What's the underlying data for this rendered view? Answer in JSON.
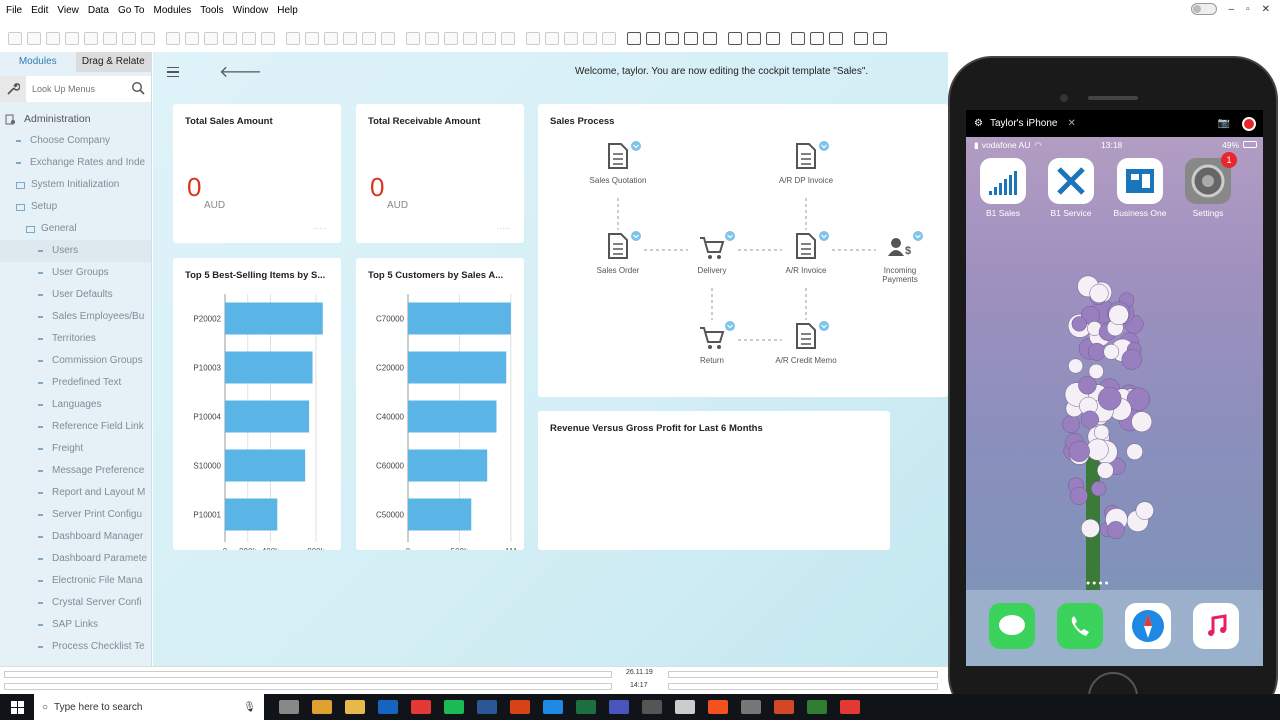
{
  "menu": [
    "File",
    "Edit",
    "View",
    "Data",
    "Go To",
    "Modules",
    "Tools",
    "Window",
    "Help"
  ],
  "window_controls": {
    "minimize": "–",
    "restore": "▫",
    "close": "✕"
  },
  "sidebar": {
    "tabs": [
      "Modules",
      "Drag & Relate"
    ],
    "search_placeholder": "Look Up Menus",
    "root": "Administration",
    "items": [
      {
        "label": "Choose Company",
        "type": "leaf",
        "level": 1
      },
      {
        "label": "Exchange Rates and Inde",
        "type": "leaf",
        "level": 1
      },
      {
        "label": "System Initialization",
        "type": "folder",
        "level": 1
      },
      {
        "label": "Setup",
        "type": "folder",
        "level": 1
      },
      {
        "label": "General",
        "type": "folder",
        "level": 2
      },
      {
        "label": "Users",
        "type": "leaf",
        "level": 3,
        "selected": true
      },
      {
        "label": "User Groups",
        "type": "leaf",
        "level": 3
      },
      {
        "label": "User Defaults",
        "type": "leaf",
        "level": 3
      },
      {
        "label": "Sales Employees/Bu",
        "type": "leaf",
        "level": 3
      },
      {
        "label": "Territories",
        "type": "leaf",
        "level": 3
      },
      {
        "label": "Commission Groups",
        "type": "leaf",
        "level": 3
      },
      {
        "label": "Predefined Text",
        "type": "leaf",
        "level": 3
      },
      {
        "label": "Languages",
        "type": "leaf",
        "level": 3
      },
      {
        "label": "Reference Field Link",
        "type": "leaf",
        "level": 3
      },
      {
        "label": "Freight",
        "type": "leaf",
        "level": 3
      },
      {
        "label": "Message Preference",
        "type": "leaf",
        "level": 3
      },
      {
        "label": "Report and Layout M",
        "type": "leaf",
        "level": 3
      },
      {
        "label": "Server Print Configu",
        "type": "leaf",
        "level": 3
      },
      {
        "label": "Dashboard Manager",
        "type": "leaf",
        "level": 3
      },
      {
        "label": "Dashboard Paramete",
        "type": "leaf",
        "level": 3
      },
      {
        "label": "Electronic File Mana",
        "type": "leaf",
        "level": 3
      },
      {
        "label": "Crystal Server Confi",
        "type": "leaf",
        "level": 3
      },
      {
        "label": "SAP Links",
        "type": "leaf",
        "level": 3
      },
      {
        "label": "Process Checklist Te",
        "type": "leaf",
        "level": 3
      }
    ]
  },
  "header": {
    "welcome": "Welcome, taylor. You are now editing the cockpit template \"Sales\"."
  },
  "kpis": [
    {
      "title": "Total Sales Amount",
      "value": "0",
      "unit": "AUD"
    },
    {
      "title": "Total Receivable Amount",
      "value": "0",
      "unit": "AUD"
    }
  ],
  "sales_process": {
    "title": "Sales Process",
    "nodes": [
      "Sales Quotation",
      "A/R DP Invoice",
      "Sales Order",
      "Delivery",
      "A/R Invoice",
      "Incoming Payments",
      "Return",
      "A/R Credit Memo"
    ]
  },
  "revenue_card": {
    "title": "Revenue Versus Gross Profit for Last 6 Months"
  },
  "chart_data": [
    {
      "type": "bar",
      "title": "Top 5 Best-Selling Items by S...",
      "categories": [
        "P20002",
        "P10003",
        "P10004",
        "S10000",
        "P10001"
      ],
      "values": [
        860000,
        770000,
        740000,
        705000,
        460000
      ],
      "xlim": [
        0,
        950000
      ],
      "ticks": [
        {
          "label": "0",
          "value": 0
        },
        {
          "label": "200k",
          "value": 200000
        },
        {
          "label": "400k",
          "value": 400000
        },
        {
          "label": "800k",
          "value": 800000
        }
      ],
      "color": "#5ab4e5"
    },
    {
      "type": "bar",
      "title": "Top 5 Customers by Sales A...",
      "categories": [
        "C70000",
        "C20000",
        "C40000",
        "C60000",
        "C50000"
      ],
      "values": [
        1000000,
        955000,
        860000,
        770000,
        615000
      ],
      "xlim": [
        0,
        1050000
      ],
      "ticks": [
        {
          "label": "0",
          "value": 0
        },
        {
          "label": "500k",
          "value": 500000
        },
        {
          "label": "1M",
          "value": 1000000
        }
      ],
      "color": "#5ab4e5"
    }
  ],
  "statusbar": {
    "date": "26.11.19",
    "time": "14:17"
  },
  "phone": {
    "title": "Taylor's iPhone",
    "carrier": "vodafone AU",
    "time": "13:18",
    "battery": "49%",
    "apps": [
      {
        "label": "B1 Sales",
        "icon": "b1-sales-icon"
      },
      {
        "label": "B1 Service",
        "icon": "b1-service-icon"
      },
      {
        "label": "Business One",
        "icon": "business-one-icon"
      },
      {
        "label": "Settings",
        "icon": "settings-icon",
        "badge": "1"
      }
    ],
    "dock": [
      "messages-icon",
      "phone-icon",
      "safari-icon",
      "music-icon"
    ]
  },
  "taskbar": {
    "search_placeholder": "Type here to search"
  },
  "colors": {
    "accent": "#2e7cb3",
    "kpi": "#d9361f",
    "bar": "#5ab4e5"
  }
}
